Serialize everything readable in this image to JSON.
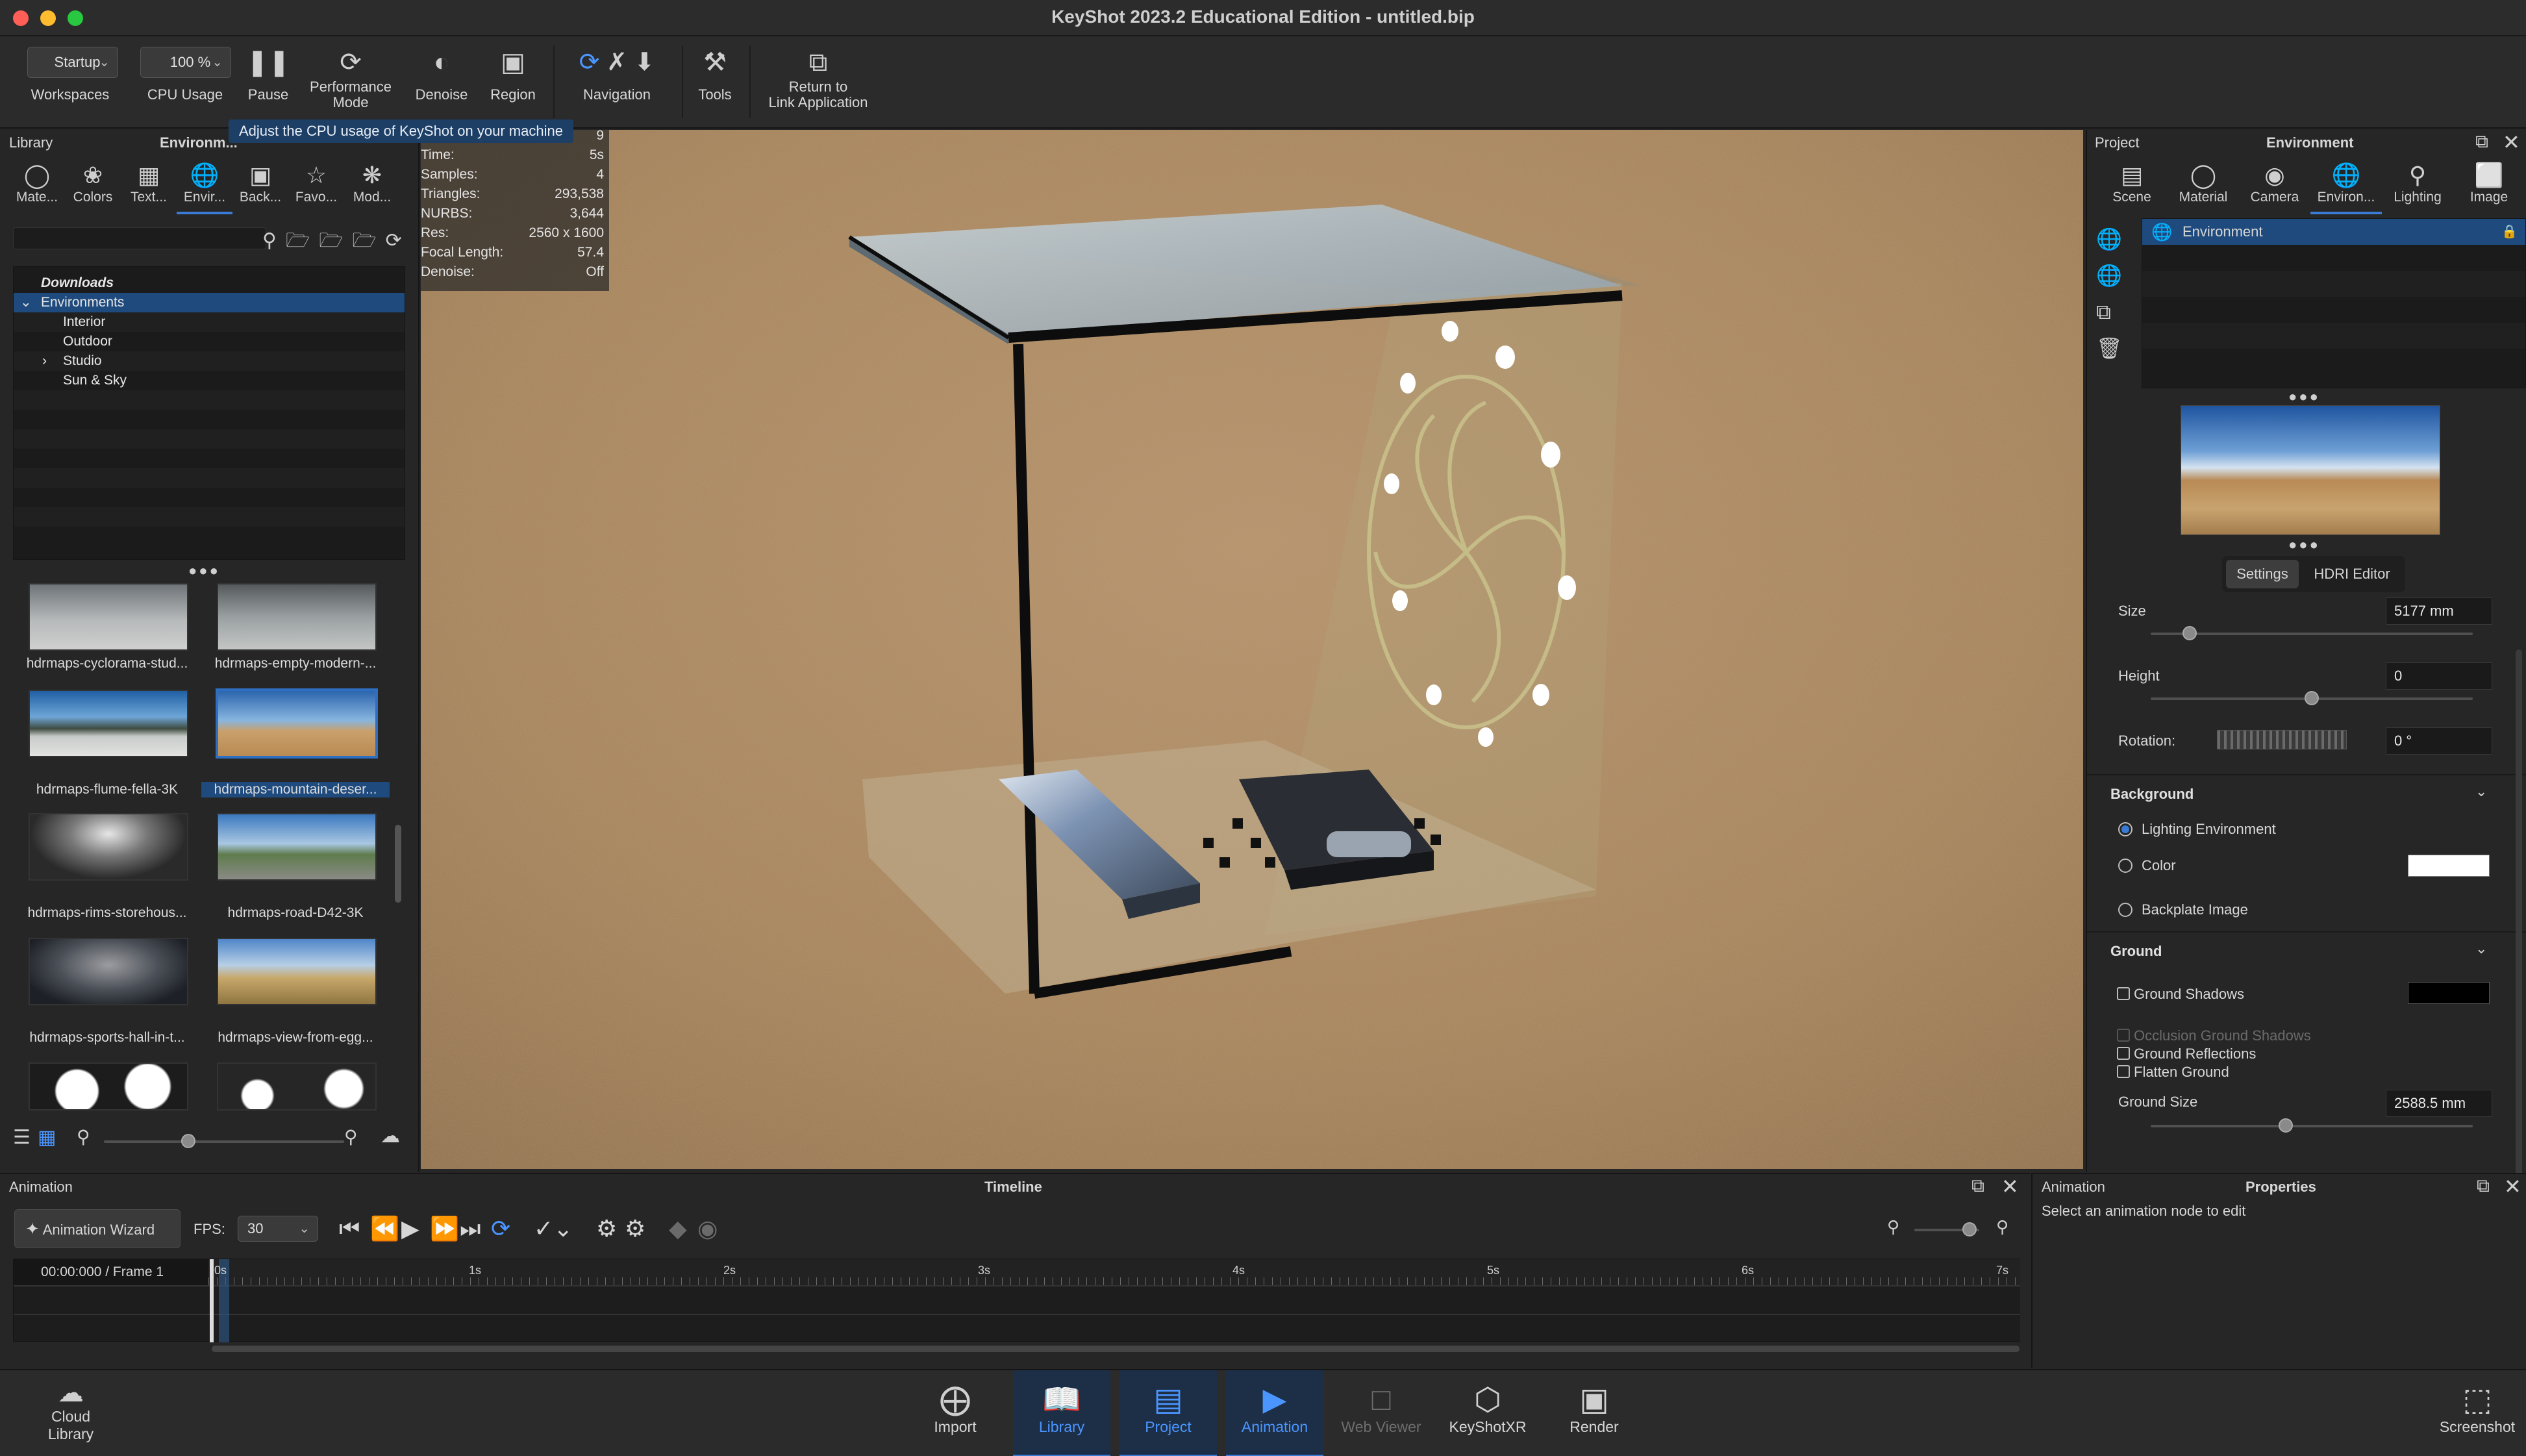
{
  "window": {
    "title": "KeyShot 2023.2 Educational Edition  - untitled.bip",
    "traffic_colors": [
      "#ff5f57",
      "#febc2e",
      "#28c840"
    ]
  },
  "toolbar": {
    "workspace_value": "Startup",
    "workspace_label": "Workspaces",
    "cpu_value": "100 %",
    "cpu_label": "CPU Usage",
    "pause_label": "Pause",
    "performance_label_1": "Performance",
    "performance_label_2": "Mode",
    "denoise_label": "Denoise",
    "region_label": "Region",
    "navigation_label": "Navigation",
    "tools_label": "Tools",
    "return_label_1": "Return to",
    "return_label_2": "Link Application",
    "tooltip": "Adjust the CPU usage of KeyShot on your machine"
  },
  "library": {
    "header_left": "Library",
    "header_center": "Environm...",
    "tabs": [
      {
        "label": "Mate...",
        "icon": "material-icon"
      },
      {
        "label": "Colors",
        "icon": "palette-icon"
      },
      {
        "label": "Text...",
        "icon": "texture-icon"
      },
      {
        "label": "Envir...",
        "icon": "globe-icon"
      },
      {
        "label": "Back...",
        "icon": "image-icon"
      },
      {
        "label": "Favo...",
        "icon": "star-icon"
      },
      {
        "label": "Mod...",
        "icon": "models-icon"
      }
    ],
    "tree": {
      "downloads": "Downloads",
      "environments": "Environments",
      "children": [
        "Interior",
        "Outdoor",
        "Studio",
        "Sun & Sky"
      ]
    },
    "thumbnails": [
      "hdrmaps-cyclorama-stud...",
      "hdrmaps-empty-modern-...",
      "hdrmaps-flume-fella-3K",
      "hdrmaps-mountain-deser...",
      "hdrmaps-rims-storehous...",
      "hdrmaps-road-D42-3K",
      "hdrmaps-sports-hall-in-t...",
      "hdrmaps-view-from-egg..."
    ],
    "size_slider_value": 0.35
  },
  "stats": {
    "partial_top": "9",
    "rows": [
      {
        "k": "Time:",
        "v": "5s"
      },
      {
        "k": "Samples:",
        "v": "4"
      },
      {
        "k": "Triangles:",
        "v": "293,538"
      },
      {
        "k": "NURBS:",
        "v": "3,644"
      },
      {
        "k": "Res:",
        "v": "2560 x 1600"
      },
      {
        "k": "Focal Length:",
        "v": "57.4"
      },
      {
        "k": "Denoise:",
        "v": "Off"
      }
    ]
  },
  "project": {
    "header_left": "Project",
    "header_center": "Environment",
    "tabs": [
      {
        "label": "Scene",
        "icon": "scene-icon"
      },
      {
        "label": "Material",
        "icon": "material-icon"
      },
      {
        "label": "Camera",
        "icon": "camera-icon"
      },
      {
        "label": "Environ...",
        "icon": "globe-icon"
      },
      {
        "label": "Lighting",
        "icon": "bulb-icon"
      },
      {
        "label": "Image",
        "icon": "image-frame-icon"
      }
    ],
    "env_list_item": "Environment",
    "subtabs": [
      "Settings",
      "HDRI Editor"
    ],
    "size_label": "Size",
    "size_value": "5177 mm",
    "size_slider": 0.12,
    "height_label": "Height",
    "height_value": "0",
    "height_slider": 0.5,
    "rotation_label": "Rotation:",
    "rotation_value": "0 °",
    "background": {
      "title": "Background",
      "options": [
        "Lighting Environment",
        "Color",
        "Backplate Image"
      ],
      "selected": 0,
      "color_swatch": "#ffffff"
    },
    "ground": {
      "title": "Ground",
      "shadows": "Ground Shadows",
      "shadow_color": "#000000",
      "occlusion": "Occlusion Ground Shadows",
      "reflections": "Ground Reflections",
      "flatten": "Flatten Ground",
      "size_label": "Ground Size",
      "size_value": "2588.5 mm",
      "size_slider": 0.42
    }
  },
  "animation": {
    "header_left": "Animation",
    "header_center": "Timeline",
    "wizard_label": "Animation Wizard",
    "fps_label": "FPS:",
    "fps_value": "30",
    "time_readout": "00:00:000 / Frame 1",
    "ticks": [
      "0s",
      "1s",
      "2s",
      "3s",
      "4s",
      "5s",
      "6s",
      "7s"
    ]
  },
  "properties": {
    "header_left": "Animation",
    "header_center": "Properties",
    "message": "Select an animation node to edit"
  },
  "bottombar": {
    "cloud_label_1": "Cloud",
    "cloud_label_2": "Library",
    "items": [
      "Import",
      "Library",
      "Project",
      "Animation",
      "Web Viewer",
      "KeyShotXR",
      "Render"
    ],
    "screenshot_label": "Screenshot"
  },
  "colors": {
    "accent": "#3a7bd5",
    "selection": "#1e4a7e"
  }
}
